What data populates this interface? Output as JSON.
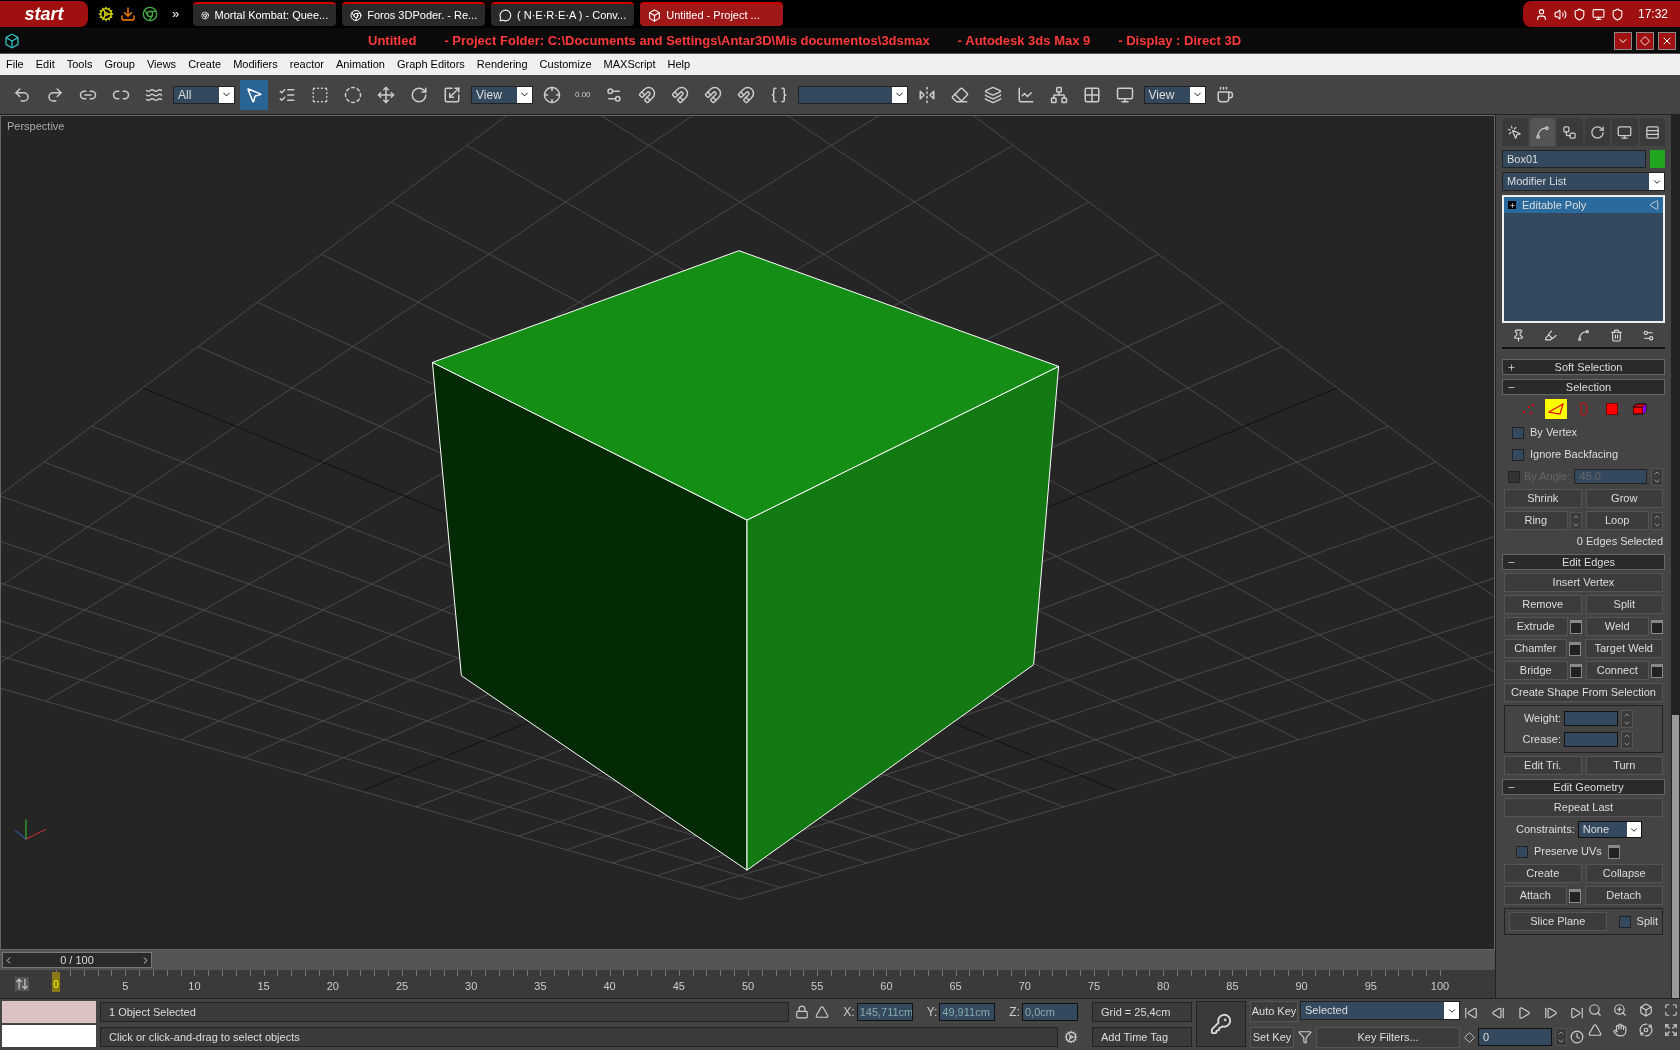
{
  "taskbar": {
    "start": "start",
    "overflow": "»",
    "clock": "17:32",
    "tasks": [
      {
        "label": "Mortal Kombat: Quee...",
        "kind": "browser",
        "selected": false
      },
      {
        "label": "Foros 3DPoder. - Re...",
        "kind": "browser",
        "selected": false
      },
      {
        "label": "( N·E·R·E·A ) - Conv...",
        "kind": "messenger",
        "selected": false
      },
      {
        "label": "Untitled - Project ...",
        "kind": "max",
        "selected": true
      }
    ]
  },
  "title_bar": {
    "parts": [
      "Untitled",
      "- Project Folder: C:\\Documents and Settings\\Antar3D\\Mis documentos\\3dsmax",
      "- Autodesk 3ds Max 9",
      "- Display : Direct 3D"
    ]
  },
  "menu": [
    "File",
    "Edit",
    "Tools",
    "Group",
    "Views",
    "Create",
    "Modifiers",
    "reactor",
    "Animation",
    "Graph Editors",
    "Rendering",
    "Customize",
    "MAXScript",
    "Help"
  ],
  "toolbar": [
    {
      "kind": "undo",
      "selected": false
    },
    {
      "kind": "redo",
      "selected": false
    },
    {
      "kind": "link",
      "selected": false
    },
    {
      "kind": "unlink",
      "selected": false
    },
    {
      "kind": "bind",
      "selected": false
    },
    {
      "kind": "dropdown",
      "value": "All"
    },
    {
      "kind": "select",
      "selected": true
    },
    {
      "kind": "select_by_name",
      "selected": false
    },
    {
      "kind": "region",
      "selected": false
    },
    {
      "kind": "window",
      "selected": false
    },
    {
      "kind": "move",
      "selected": false
    },
    {
      "kind": "rotate",
      "selected": false
    },
    {
      "kind": "scale",
      "selected": false
    },
    {
      "kind": "dropdown",
      "value": "View"
    },
    {
      "kind": "pivot",
      "selected": false
    },
    {
      "kind": "text_tool",
      "label": "0.00",
      "selected": false
    },
    {
      "kind": "manipulate",
      "selected": false
    },
    {
      "kind": "snap",
      "selected": false
    },
    {
      "kind": "angle_snap",
      "selected": false
    },
    {
      "kind": "percent_snap",
      "selected": false
    },
    {
      "kind": "spinner_snap",
      "selected": false
    },
    {
      "kind": "named_sets",
      "selected": false
    },
    {
      "kind": "field"
    },
    {
      "kind": "mirror",
      "selected": false
    },
    {
      "kind": "align",
      "selected": false
    },
    {
      "kind": "layers",
      "selected": false
    },
    {
      "kind": "curve_editor",
      "selected": false
    },
    {
      "kind": "schematic",
      "selected": false
    },
    {
      "kind": "material",
      "selected": false
    },
    {
      "kind": "render_setup",
      "selected": false
    },
    {
      "kind": "dropdown",
      "value": "View"
    },
    {
      "kind": "render",
      "selected": false
    }
  ],
  "viewport": {
    "label": "Perspective"
  },
  "command_panel": {
    "tabs": [
      {
        "kind": "create",
        "selected": false
      },
      {
        "kind": "modify",
        "selected": true
      },
      {
        "kind": "hierarchy",
        "selected": false
      },
      {
        "kind": "motion",
        "selected": false
      },
      {
        "kind": "display",
        "selected": false
      },
      {
        "kind": "utilities",
        "selected": false
      }
    ],
    "object_name": "Box01",
    "modifier_list": "Modifier List",
    "stack": [
      {
        "label": "Editable Poly",
        "selected": true,
        "expanded": false
      }
    ],
    "rollouts": [
      {
        "title": "Soft Selection",
        "expanded": false
      },
      {
        "title": "Selection",
        "expanded": true,
        "rows": [
          {
            "kind": "subobjects",
            "items": [
              {
                "kind": "vertex",
                "selected": false
              },
              {
                "kind": "edge",
                "selected": true
              },
              {
                "kind": "border",
                "selected": false
              },
              {
                "kind": "polygon",
                "selected": false
              },
              {
                "kind": "element",
                "selected": false
              }
            ]
          },
          {
            "kind": "line",
            "items": [
              {
                "kind": "check",
                "label": "By Vertex",
                "checked": false,
                "disabled": false
              }
            ]
          },
          {
            "kind": "line",
            "items": [
              {
                "kind": "check",
                "label": "Ignore Backfacing",
                "checked": false,
                "disabled": false
              }
            ]
          },
          {
            "kind": "line",
            "items": [
              {
                "kind": "check_spinner",
                "label": "By Angle:",
                "value": "45,0",
                "checked": false,
                "disabled": true
              }
            ]
          },
          {
            "kind": "line",
            "items": [
              {
                "kind": "button",
                "label": "Shrink"
              },
              {
                "kind": "button",
                "label": "Grow"
              }
            ]
          },
          {
            "kind": "line",
            "items": [
              {
                "kind": "spinner_button",
                "label": "Ring"
              },
              {
                "kind": "spinner_button",
                "label": "Loop"
              }
            ]
          },
          {
            "kind": "line",
            "items": [
              {
                "kind": "status",
                "label": "0 Edges Selected"
              }
            ]
          }
        ]
      },
      {
        "title": "Edit Edges",
        "expanded": true,
        "rows": [
          {
            "kind": "line",
            "items": [
              {
                "kind": "button",
                "label": "Insert Vertex"
              }
            ]
          },
          {
            "kind": "line",
            "items": [
              {
                "kind": "button",
                "label": "Remove"
              },
              {
                "kind": "button",
                "label": "Split"
              }
            ]
          },
          {
            "kind": "line",
            "items": [
              {
                "kind": "settings_button",
                "label": "Extrude"
              },
              {
                "kind": "settings_button",
                "label": "Weld"
              }
            ]
          },
          {
            "kind": "line",
            "items": [
              {
                "kind": "settings_button",
                "label": "Chamfer"
              },
              {
                "kind": "button",
                "label": "Target Weld"
              }
            ]
          },
          {
            "kind": "line",
            "items": [
              {
                "kind": "settings_button",
                "label": "Bridge"
              },
              {
                "kind": "settings_button",
                "label": "Connect"
              }
            ]
          },
          {
            "kind": "line",
            "items": [
              {
                "kind": "button",
                "label": "Create Shape From Selection"
              }
            ]
          },
          {
            "kind": "group",
            "rows": [
              {
                "kind": "line",
                "items": [
                  {
                    "kind": "spinner_field",
                    "label": "Weight:"
                  }
                ]
              },
              {
                "kind": "line",
                "items": [
                  {
                    "kind": "spinner_field",
                    "label": "Crease:"
                  }
                ]
              }
            ]
          },
          {
            "kind": "line",
            "items": [
              {
                "kind": "button",
                "label": "Edit Tri."
              },
              {
                "kind": "button",
                "label": "Turn"
              }
            ]
          }
        ]
      },
      {
        "title": "Edit Geometry",
        "expanded": true,
        "rows": [
          {
            "kind": "line",
            "items": [
              {
                "kind": "button",
                "label": "Repeat Last"
              }
            ]
          },
          {
            "kind": "line",
            "items": [
              {
                "kind": "dropdown",
                "label": "Constraints:",
                "value": "None"
              }
            ]
          },
          {
            "kind": "line",
            "items": [
              {
                "kind": "check_settings",
                "label": "Preserve UVs",
                "checked": false,
                "disabled": false
              }
            ]
          },
          {
            "kind": "line",
            "items": [
              {
                "kind": "button",
                "label": "Create"
              },
              {
                "kind": "button",
                "label": "Collapse"
              }
            ]
          },
          {
            "kind": "line",
            "items": [
              {
                "kind": "settings_button",
                "label": "Attach"
              },
              {
                "kind": "button",
                "label": "Detach"
              }
            ]
          },
          {
            "kind": "group",
            "rows": [
              {
                "kind": "line",
                "items": [
                  {
                    "kind": "button",
                    "label": "Slice Plane"
                  },
                  {
                    "kind": "check",
                    "label": "Split",
                    "checked": false,
                    "disabled": false
                  }
                ]
              }
            ]
          }
        ]
      }
    ]
  },
  "time_slider": {
    "label": "0 / 100",
    "level": 0
  },
  "timeline": {
    "current": "0",
    "labels": [
      "5",
      "10",
      "15",
      "20",
      "25",
      "30",
      "35",
      "40",
      "45",
      "50",
      "55",
      "60",
      "65",
      "70",
      "75",
      "80",
      "85",
      "90",
      "95",
      "100"
    ]
  },
  "status_bar": {
    "selection": "1 Object Selected",
    "prompt": "Click or click-and-drag to select objects",
    "coords": [
      {
        "axis": "X:",
        "value": "145,711cm"
      },
      {
        "axis": "Y:",
        "value": "49,911cm"
      },
      {
        "axis": "Z:",
        "value": "0,0cm"
      }
    ],
    "grid": "Grid = 25,4cm",
    "time_tag": "Add Time Tag",
    "auto_key": "Auto Key",
    "set_key": "Set Key",
    "key_mode": "Selected",
    "key_filters": "Key Filters...",
    "frame": "0"
  }
}
